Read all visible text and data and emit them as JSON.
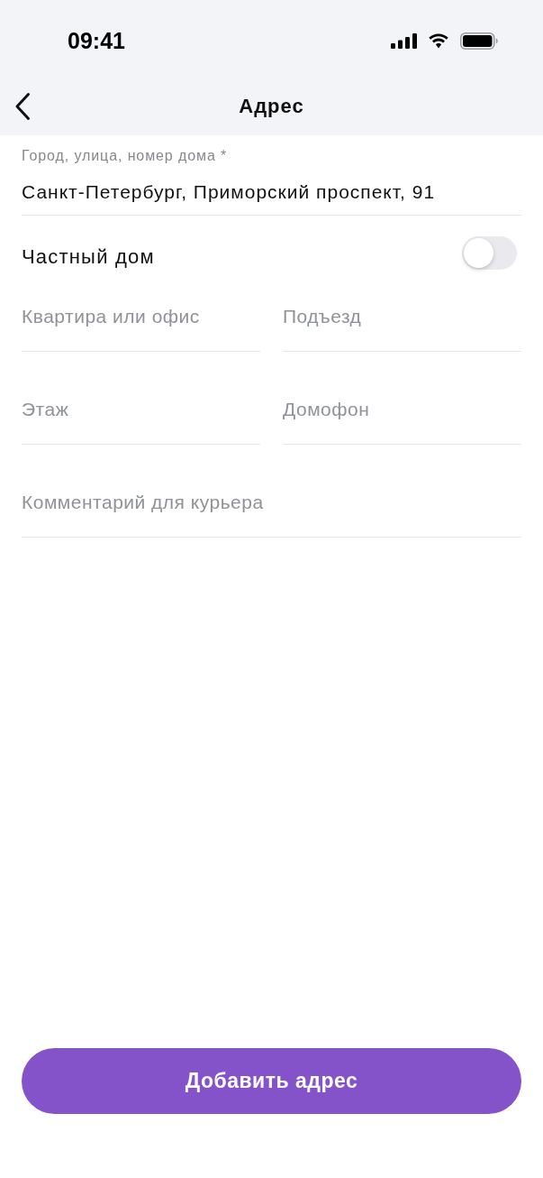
{
  "status_bar": {
    "time": "09:41"
  },
  "header": {
    "title": "Адрес"
  },
  "address_field": {
    "label": "Город, улица, номер дома *",
    "value": "Санкт-Петербург, Приморский проспект, 91"
  },
  "private_house": {
    "label": "Частный дом",
    "on": false
  },
  "field_rows": [
    {
      "fields": [
        {
          "placeholder": "Квартира или офис"
        },
        {
          "placeholder": "Подъезд"
        }
      ]
    },
    {
      "fields": [
        {
          "placeholder": "Этаж"
        },
        {
          "placeholder": "Домофон"
        }
      ]
    },
    {
      "fields": [
        {
          "placeholder": "Комментарий для курьера"
        }
      ]
    }
  ],
  "submit_button": {
    "label": "Добавить адрес"
  }
}
